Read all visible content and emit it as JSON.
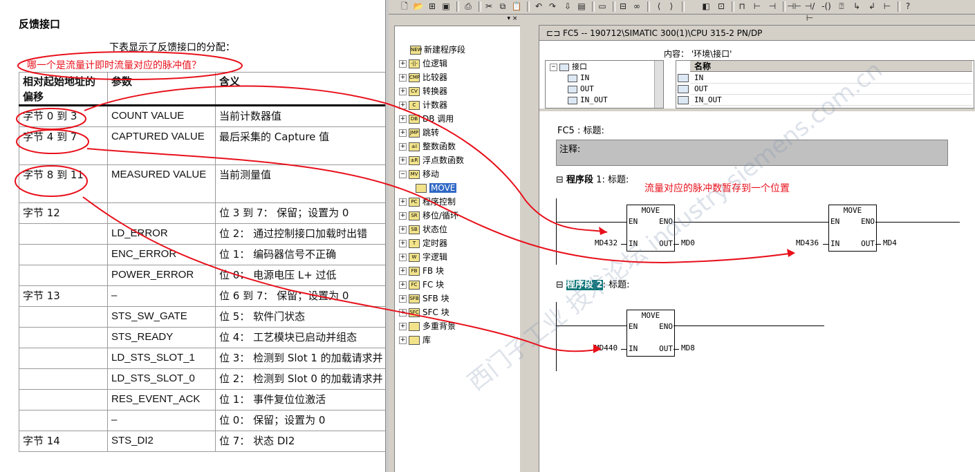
{
  "doc": {
    "title": "反馈接口",
    "intro": "下表显示了反馈接口的分配：",
    "question": "哪一个是流量计即时流量对应的脉冲值？",
    "headers": [
      "相对起始地址的偏移",
      "参数",
      "含义"
    ],
    "rows": [
      {
        "offset": "字节 0 到 3",
        "param": "COUNT VALUE",
        "meaning": "当前计数器值"
      },
      {
        "offset": "字节 4 到 7",
        "param": "CAPTURED VALUE",
        "meaning": "最后采集的 Capture 值"
      },
      {
        "offset": "字节 8 到 11",
        "param": "MEASURED VALUE",
        "meaning": "当前测量值"
      },
      {
        "offset": "字节 12",
        "param": "",
        "meaning": "位 3 到 7： 保留；设置为 0"
      },
      {
        "offset": "",
        "param": "LD_ERROR",
        "meaning": "位 2： 通过控制接口加载时出错"
      },
      {
        "offset": "",
        "param": "ENC_ERROR",
        "meaning": "位 1： 编码器信号不正确"
      },
      {
        "offset": "",
        "param": "POWER_ERROR",
        "meaning": "位 0： 电源电压 L+ 过低"
      },
      {
        "offset": "字节 13",
        "param": "–",
        "meaning": "位 6 到 7： 保留；设置为 0"
      },
      {
        "offset": "",
        "param": "STS_SW_GATE",
        "meaning": "位 5： 软件门状态"
      },
      {
        "offset": "",
        "param": "STS_READY",
        "meaning": "位 4： 工艺模块已启动并组态"
      },
      {
        "offset": "",
        "param": "LD_STS_SLOT_1",
        "meaning": "位 3： 检测到 Slot 1 的加载请求并"
      },
      {
        "offset": "",
        "param": "LD_STS_SLOT_0",
        "meaning": "位 2： 检测到 Slot 0 的加载请求并"
      },
      {
        "offset": "",
        "param": "RES_EVENT_ACK",
        "meaning": "位 1： 事件复位位激活"
      },
      {
        "offset": "",
        "param": "–",
        "meaning": "位 0： 保留；设置为 0"
      },
      {
        "offset": "字节 14",
        "param": "STS_DI2",
        "meaning": "位 7： 状态 DI2"
      }
    ]
  },
  "catalog": {
    "items": [
      {
        "label": "新建程序段",
        "icon": "new-network-icon",
        "tag": "NEW"
      },
      {
        "label": "位逻辑",
        "icon": "bit-logic-icon",
        "tag": "-||-"
      },
      {
        "label": "比较器",
        "icon": "comparator-icon",
        "tag": "CMP"
      },
      {
        "label": "转换器",
        "icon": "converter-icon",
        "tag": "CV"
      },
      {
        "label": "计数器",
        "icon": "counter-icon",
        "tag": "C"
      },
      {
        "label": "DB 调用",
        "icon": "db-call-icon",
        "tag": "DB"
      },
      {
        "label": "跳转",
        "icon": "jump-icon",
        "tag": "JMP"
      },
      {
        "label": "整数函数",
        "icon": "integer-function-icon",
        "tag": "±I"
      },
      {
        "label": "浮点数函数",
        "icon": "float-function-icon",
        "tag": "±R"
      },
      {
        "label": "移动",
        "icon": "move-folder-icon",
        "tag": "MV"
      },
      {
        "label": "MOVE",
        "icon": "move-block-icon",
        "tag": ""
      },
      {
        "label": "程序控制",
        "icon": "program-control-icon",
        "tag": "PC"
      },
      {
        "label": "移位/循环",
        "icon": "shift-rotate-icon",
        "tag": "SR"
      },
      {
        "label": "状态位",
        "icon": "status-bit-icon",
        "tag": "SB"
      },
      {
        "label": "定时器",
        "icon": "timer-icon",
        "tag": "T"
      },
      {
        "label": "字逻辑",
        "icon": "word-logic-icon",
        "tag": "W"
      },
      {
        "label": "FB 块",
        "icon": "fb-block-icon",
        "tag": "FB"
      },
      {
        "label": "FC 块",
        "icon": "fc-block-icon",
        "tag": "FC"
      },
      {
        "label": "SFB 块",
        "icon": "sfb-block-icon",
        "tag": "SFB"
      },
      {
        "label": "SFC 块",
        "icon": "sfc-block-icon",
        "tag": "SFC"
      },
      {
        "label": "多重背景",
        "icon": "multi-instance-icon",
        "tag": ""
      },
      {
        "label": "库",
        "icon": "library-icon",
        "tag": ""
      }
    ]
  },
  "editor": {
    "title": "FC5 -- 190712\\SIMATIC 300(1)\\CPU 315-2 PN/DP",
    "content_label": "内容：  '环境\\接口'",
    "interface_root": "接口",
    "interface_items": [
      "IN",
      "OUT",
      "IN_OUT"
    ],
    "name_header": "名称",
    "name_rows": [
      "IN",
      "OUT",
      "IN_OUT"
    ],
    "fc_title": "FC5 : 标题:",
    "comment": "注释:",
    "seg1_title_prefix": "程序段",
    "seg1_title_rest": " 1: 标题:",
    "seg1_annotation": "流量对应的脉冲数暂存到一个位置",
    "seg2_title_prefix": "程序段 2",
    "seg2_title_rest": ": 标题:",
    "move_label": "MOVE",
    "pin_en": "EN",
    "pin_eno": "ENO",
    "pin_in": "IN",
    "pin_out": "OUT",
    "m1_in": "MD432",
    "m1_out": "MD0",
    "m2_in": "MD436",
    "m2_out": "MD4",
    "m3_in": "MD440",
    "m3_out": "MD8"
  },
  "watermark": "西门子工业 技术论坛 industry.siemens.com.cn",
  "colors": {
    "annotation": "#e8101b",
    "selection": "#3169c6",
    "segment_highlight": "#0a7476",
    "chrome": "#d4d0c8"
  }
}
